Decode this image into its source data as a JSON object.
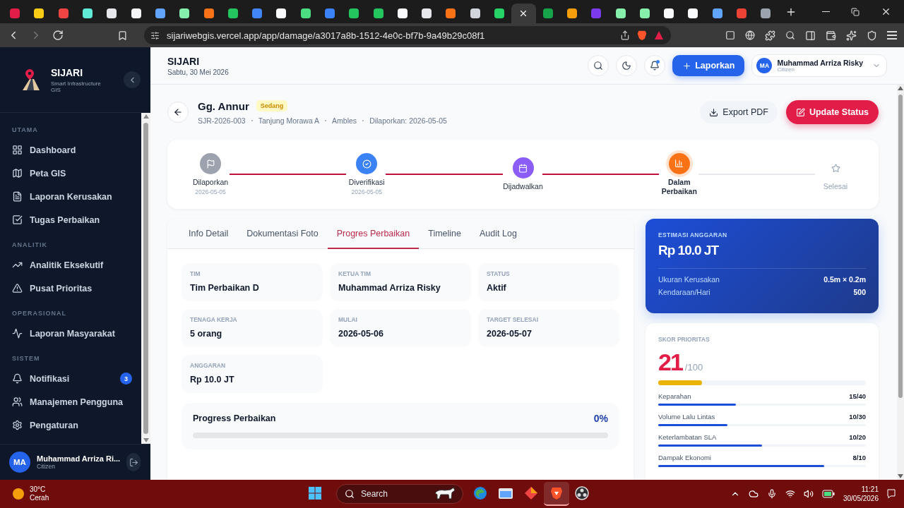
{
  "browser": {
    "tabs": [
      {
        "color": "#e11d48",
        "selected": false
      },
      {
        "color": "#facc15",
        "selected": false
      },
      {
        "color": "#ef4444",
        "selected": false
      },
      {
        "color": "#5eead4",
        "selected": false
      },
      {
        "color": "#e5e7eb",
        "selected": false
      },
      {
        "color": "#f3f4f6",
        "selected": false
      },
      {
        "color": "#60a5fa",
        "selected": false
      },
      {
        "color": "#86efac",
        "selected": false
      },
      {
        "color": "#f97316",
        "selected": false
      },
      {
        "color": "#22c55e",
        "selected": false
      },
      {
        "color": "#4285f4",
        "selected": false
      },
      {
        "color": "#f9fafb",
        "selected": false
      },
      {
        "color": "#4ade80",
        "selected": false
      },
      {
        "color": "#3b82f6",
        "selected": false
      },
      {
        "color": "#22c55e",
        "selected": false
      },
      {
        "color": "#22c55e",
        "selected": false
      },
      {
        "color": "#f9fafb",
        "selected": false
      },
      {
        "color": "#e5e7eb",
        "selected": false
      },
      {
        "color": "#f97316",
        "selected": false
      },
      {
        "color": "#d1d5db",
        "selected": false
      },
      {
        "color": "#25d366",
        "selected": false
      },
      {
        "color": "#ffffff",
        "selected": true
      },
      {
        "color": "#16a34a",
        "selected": false
      },
      {
        "color": "#f59e0b",
        "selected": false
      },
      {
        "color": "#7c3aed",
        "selected": false
      },
      {
        "color": "#86efac",
        "selected": false
      },
      {
        "color": "#86efac",
        "selected": false
      },
      {
        "color": "#f9fafb",
        "selected": false
      },
      {
        "color": "#f9fafb",
        "selected": false
      },
      {
        "color": "#60a5fa",
        "selected": false
      },
      {
        "color": "#ea4335",
        "selected": false
      },
      {
        "color": "#9ca3af",
        "selected": false
      }
    ],
    "url": "sijariwebgis.vercel.app/app/damage/a3017a8b-1512-4e0c-bf7b-9a49b29c08f1"
  },
  "sidebar": {
    "brand": "SIJARI",
    "tagline": "Smart Infrastructure GIS",
    "sections": [
      {
        "title": "UTAMA",
        "items": [
          {
            "label": "Dashboard",
            "kind": "grid"
          },
          {
            "label": "Peta GIS",
            "kind": "map"
          },
          {
            "label": "Laporan Kerusakan",
            "kind": "file"
          },
          {
            "label": "Tugas Perbaikan",
            "kind": "check"
          }
        ]
      },
      {
        "title": "ANALITIK",
        "items": [
          {
            "label": "Analitik Eksekutif",
            "kind": "trend"
          },
          {
            "label": "Pusat Prioritas",
            "kind": "alert"
          }
        ]
      },
      {
        "title": "OPERASIONAL",
        "items": [
          {
            "label": "Laporan Masyarakat",
            "kind": "pulse"
          }
        ]
      },
      {
        "title": "SISTEM",
        "items": [
          {
            "label": "Notifikasi",
            "kind": "bell",
            "badge": "3"
          },
          {
            "label": "Manajemen Pengguna",
            "kind": "users"
          },
          {
            "label": "Pengaturan",
            "kind": "gear"
          }
        ]
      }
    ],
    "user": {
      "initials": "MA",
      "name": "Muhammad Arriza Ri...",
      "role": "Citizen"
    }
  },
  "header": {
    "title": "SIJARI",
    "date": "Sabtu, 30 Mei 2026",
    "unread": true,
    "report_button": "Laporkan",
    "user": {
      "initials": "MA",
      "name": "Muhammad Arriza Risky",
      "role": "Citizen"
    }
  },
  "report": {
    "title": "Gg. Annur",
    "severity": "Sedang",
    "meta": [
      "SJR-2026-003",
      "Tanjung Morawa A",
      "Ambles",
      "Dilaporkan: 2026-05-05"
    ],
    "export_button": "Export PDF",
    "update_button": "Update Status"
  },
  "steps": [
    {
      "label": "Dilaporkan",
      "date": "2026-05-05",
      "reached": true,
      "current": false,
      "kind": "flag",
      "color": "#9ca3af"
    },
    {
      "label": "Diverifikasi",
      "date": "2026-05-05",
      "reached": true,
      "current": false,
      "kind": "check",
      "color": "#3b82f6"
    },
    {
      "label": "Dijadwalkan",
      "reached": true,
      "current": false,
      "kind": "calendar",
      "color": "#8b5cf6"
    },
    {
      "label": "Dalam Perbaikan",
      "reached": true,
      "current": true,
      "kind": "chart",
      "color": "#f97316"
    },
    {
      "label": "Selesai",
      "reached": false,
      "current": false,
      "kind": "star"
    }
  ],
  "tabs": [
    {
      "label": "Info Detail",
      "selected": false
    },
    {
      "label": "Dokumentasi Foto",
      "selected": false
    },
    {
      "label": "Progres Perbaikan",
      "selected": true
    },
    {
      "label": "Timeline",
      "selected": false
    },
    {
      "label": "Audit Log",
      "selected": false
    }
  ],
  "fields": [
    {
      "label": "TIM",
      "value": "Tim Perbaikan D"
    },
    {
      "label": "KETUA TIM",
      "value": "Muhammad Arriza Risky"
    },
    {
      "label": "STATUS",
      "value": "Aktif"
    },
    {
      "label": "TENAGA KERJA",
      "value": "5 orang"
    },
    {
      "label": "MULAI",
      "value": "2026-05-06"
    },
    {
      "label": "TARGET SELESAI",
      "value": "2026-05-07"
    },
    {
      "label": "ANGGARAN",
      "value": "Rp 10.0 JT"
    }
  ],
  "progress": {
    "label": "Progress Perbaikan",
    "reading": "0%",
    "level": 0
  },
  "budget": {
    "title": "ESTIMASI ANGGARAN",
    "amount": "Rp 10.0 JT",
    "rows": [
      {
        "label": "Ukuran Kerusakan",
        "value": "0.5m × 0.2m"
      },
      {
        "label": "Kendaraan/Hari",
        "value": "500"
      }
    ]
  },
  "score": {
    "title": "SKOR PRIORITAS",
    "value": "21",
    "max": "/100",
    "level": 0.21,
    "factors": [
      {
        "label": "Keparahan",
        "reading": "15/40",
        "level": 0.375
      },
      {
        "label": "Volume Lalu Lintas",
        "reading": "10/30",
        "level": 0.333
      },
      {
        "label": "Keterlambatan SLA",
        "reading": "10/20",
        "level": 0.5
      },
      {
        "label": "Dampak Ekonomi",
        "reading": "8/10",
        "level": 0.8
      }
    ]
  },
  "taskbar": {
    "temperature": "30°C",
    "condition": "Cerah",
    "search": {
      "placeholder": "Search"
    },
    "apps": [
      {
        "kind": "windows",
        "selected": false
      },
      {
        "kind": "edge",
        "selected": false
      },
      {
        "kind": "files",
        "selected": false
      },
      {
        "kind": "diamond",
        "selected": false
      },
      {
        "kind": "brave",
        "selected": true
      },
      {
        "kind": "obs",
        "selected": false
      }
    ],
    "time": "11:21",
    "date": "30/05/2026"
  }
}
